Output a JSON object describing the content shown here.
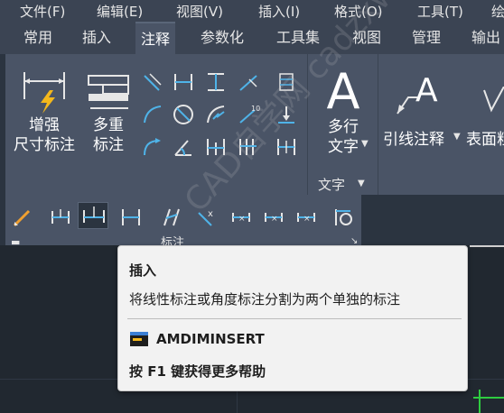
{
  "menu": [
    "文件(F)",
    "编辑(E)",
    "视图(V)",
    "插入(I)",
    "格式(O)",
    "工具(T)",
    "绘"
  ],
  "tabs": [
    {
      "label": "常用"
    },
    {
      "label": "插入"
    },
    {
      "label": "注释",
      "active": true
    },
    {
      "label": "参数化"
    },
    {
      "label": "工具集"
    },
    {
      "label": "视图"
    },
    {
      "label": "管理"
    },
    {
      "label": "输出"
    }
  ],
  "annotate": {
    "smart_dim_line1": "增强",
    "smart_dim_line2": "尺寸标注",
    "multi_dim_line1": "多重",
    "multi_dim_line2": "标注",
    "panel_title": "标注"
  },
  "text_panel": {
    "mtext_line1": "多行",
    "mtext_line2": "文字",
    "mtext_big": "A",
    "panel_title": "文字"
  },
  "leader": {
    "label": "引线注释",
    "surface_label": "表面粗"
  },
  "tooltip": {
    "title": "插入",
    "description": "将线性标注或角度标注分割为两个单独的标注",
    "command": "AMDIMINSERT",
    "help": "按 F1 键获得更多帮助"
  },
  "watermark": "CAD自学网 cadzxw.com",
  "colors": {
    "accent_icon": "#4fb3e8",
    "lightning": "#f4b81c",
    "pencil": "#f0a030"
  }
}
